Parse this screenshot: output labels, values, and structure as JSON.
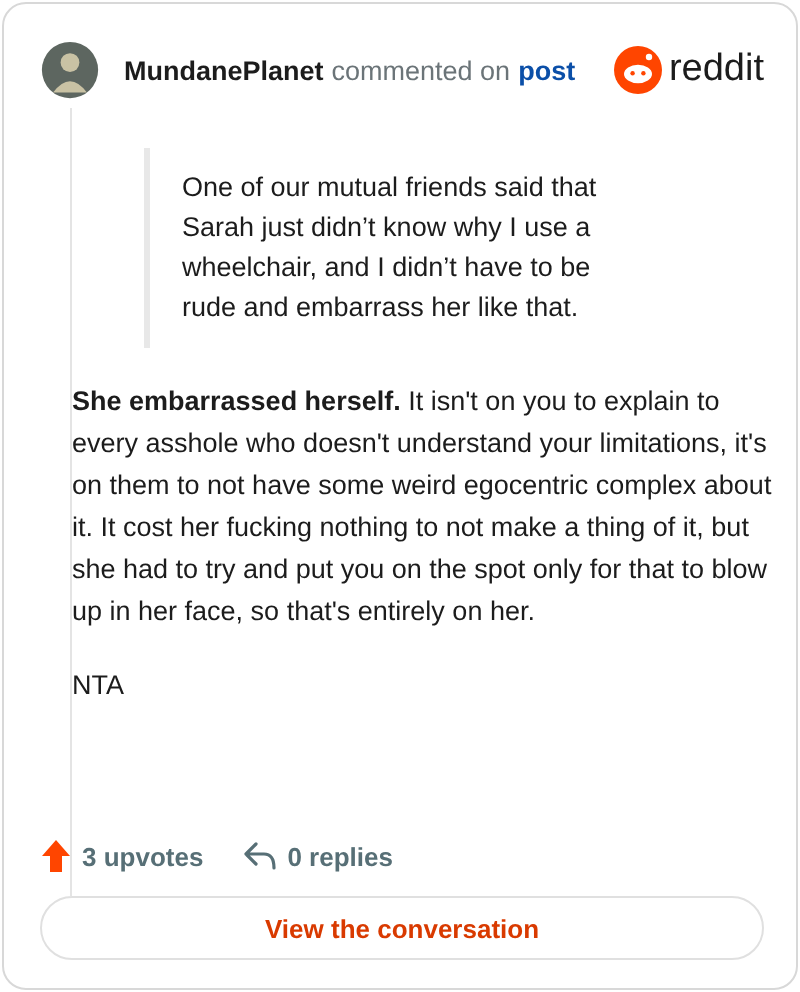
{
  "header": {
    "username": "MundanePlanet",
    "action": "commented on",
    "link": "post",
    "brand": "reddit"
  },
  "quote": "One of our mutual friends said that Sarah just didn’t know why I use a wheelchair, and I didn’t have to be rude and embarrass her like that.",
  "paragraphs": [
    "**She embarrassed herself.** It isn't on you to explain to every asshole who doesn't understand your limitations, it's on them to not have some weird egocentric complex about it. It cost her fucking nothing to not make a thing of it, but she had to try and put you on the spot only for that to blow up in her face, so that's entirely on her.",
    "NTA"
  ],
  "stats": {
    "upvotes": "3 upvotes",
    "replies": "0 replies"
  },
  "button": "View the conversation"
}
